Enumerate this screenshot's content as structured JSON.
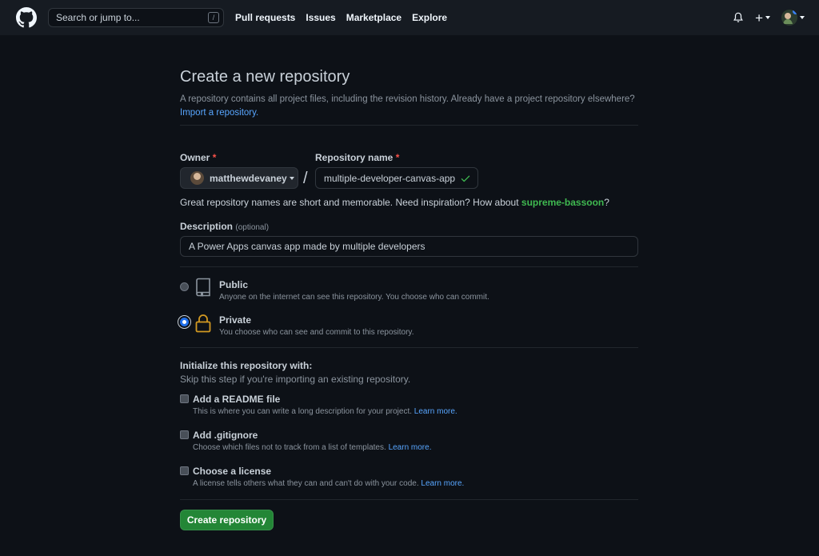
{
  "header": {
    "search_placeholder": "Search or jump to...",
    "search_key": "/",
    "nav": [
      "Pull requests",
      "Issues",
      "Marketplace",
      "Explore"
    ],
    "plus": "+"
  },
  "page": {
    "title": "Create a new repository",
    "subtitle": "A repository contains all project files, including the revision history. Already have a project repository elsewhere?",
    "import_link": "Import a repository."
  },
  "form": {
    "owner_label": "Owner",
    "required_mark": "*",
    "owner_value": "matthewdevaney",
    "separator": "/",
    "repo_label": "Repository name",
    "repo_value": "multiple-developer-canvas-app",
    "hint_prefix": "Great repository names are short and memorable. Need inspiration? How about",
    "hint_suggestion": "supreme-bassoon",
    "hint_suffix": "?",
    "description_label": "Description",
    "description_optional": "(optional)",
    "description_value": "A Power Apps canvas app made by multiple developers"
  },
  "visibility": {
    "selected": "Private",
    "options": [
      {
        "title": "Public",
        "desc": "Anyone on the internet can see this repository. You choose who can commit."
      },
      {
        "title": "Private",
        "desc": "You choose who can see and commit to this repository."
      }
    ]
  },
  "init": {
    "heading": "Initialize this repository with:",
    "subheading": "Skip this step if you're importing an existing repository.",
    "learn_more": "Learn more.",
    "options": [
      {
        "title": "Add a README file",
        "desc": "This is where you can write a long description for your project."
      },
      {
        "title": "Add .gitignore",
        "desc": "Choose which files not to track from a list of templates."
      },
      {
        "title": "Choose a license",
        "desc": "A license tells others what they can and can't do with your code."
      }
    ]
  },
  "submit_label": "Create repository",
  "colors": {
    "background": "#0d1117",
    "header": "#161b22",
    "link": "#58a6ff",
    "success": "#3fb950",
    "primary_button": "#238636",
    "required": "#f85149",
    "lock": "#d29922"
  },
  "icons": [
    "github-logo-icon",
    "bell-icon",
    "plus-icon",
    "check-icon",
    "repo-icon",
    "lock-icon"
  ]
}
